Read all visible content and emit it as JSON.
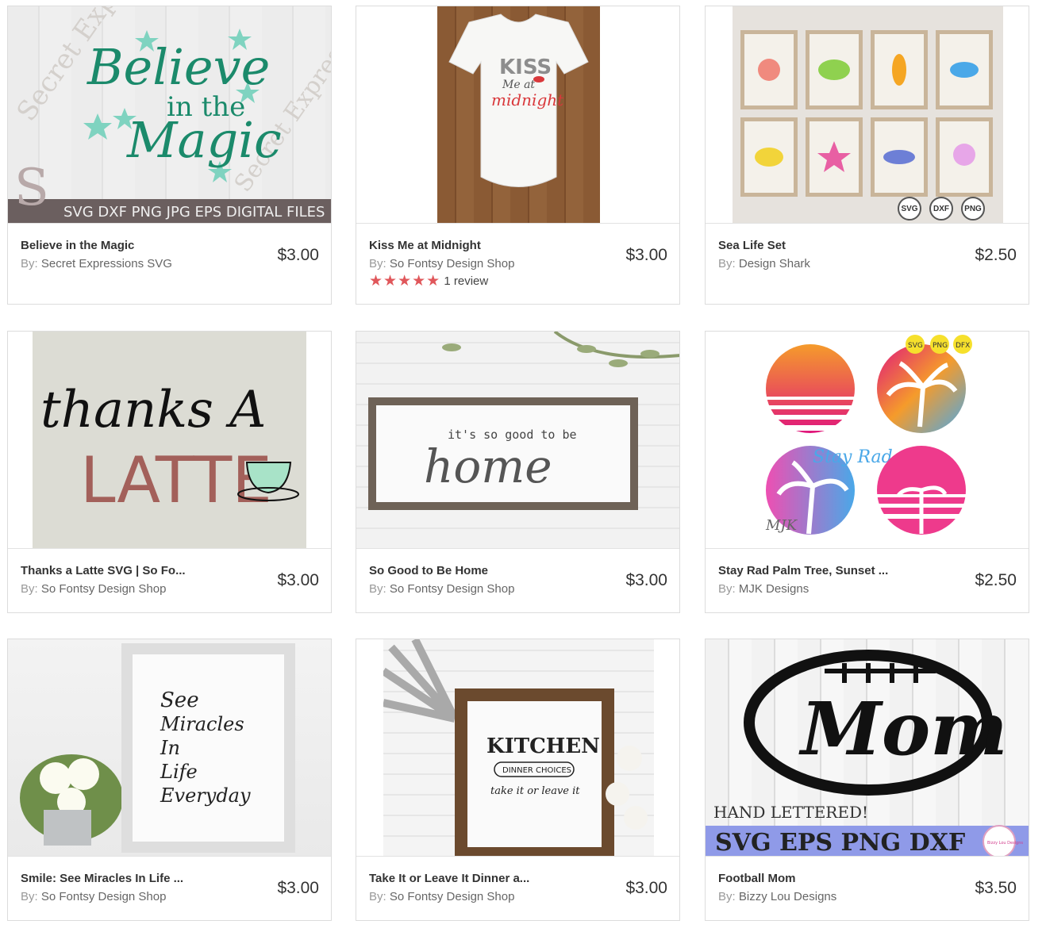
{
  "products": [
    {
      "title": "Believe in the Magic",
      "by_label": "By:",
      "author": "Secret Expressions SVG",
      "price": "$3.00",
      "art": {
        "line1": "Believe",
        "line2": "in the",
        "line3": "Magic",
        "watermark": "Secret Expressions",
        "footer": "SVG DXF PNG JPG EPS DIGITAL FILES",
        "colors": {
          "script": "#1b8a6b",
          "star": "#7fd3c0",
          "band": "#6b5f5f"
        }
      }
    },
    {
      "title": "Kiss Me at Midnight",
      "by_label": "By:",
      "author": "So Fontsy Design Shop",
      "price": "$3.00",
      "rating_stars": "★★★★★",
      "rating_text": "1 review",
      "art": {
        "line1": "KISS",
        "line2": "Me at",
        "line3": "midnight"
      }
    },
    {
      "title": "Sea Life Set",
      "by_label": "By:",
      "author": "Design Shark",
      "price": "$2.50",
      "art": {
        "chips": [
          "SVG",
          "DXF",
          "PNG"
        ]
      }
    },
    {
      "title": "Thanks a Latte SVG | So Fo...",
      "by_label": "By:",
      "author": "So Fontsy Design Shop",
      "price": "$3.00",
      "art": {
        "line1": "thanks A",
        "line2": "LATTE",
        "colors": {
          "latte": "#a3605a",
          "cup": "#a8e3c8"
        }
      }
    },
    {
      "title": "So Good to Be Home",
      "by_label": "By:",
      "author": "So Fontsy Design Shop",
      "price": "$3.00",
      "art": {
        "line1": "it's so good to be",
        "line2": "home"
      }
    },
    {
      "title": "Stay Rad Palm Tree, Sunset ...",
      "by_label": "By:",
      "author": "MJK Designs",
      "price": "$2.50",
      "art": {
        "chips": [
          "SVG",
          "PNG",
          "DFX"
        ],
        "script": "Stay Rad",
        "monogram": "MJK"
      }
    },
    {
      "title": "Smile: See Miracles In Life ...",
      "by_label": "By:",
      "author": "So Fontsy Design Shop",
      "price": "$3.00",
      "art": {
        "lines": [
          "See",
          "Miracles",
          "In",
          "Life",
          "Everyday"
        ]
      }
    },
    {
      "title": "Take It or Leave It Dinner a...",
      "by_label": "By:",
      "author": "So Fontsy Design Shop",
      "price": "$3.00",
      "art": {
        "line1": "KITCHEN",
        "line2": "DINNER CHOICES",
        "line3": "take it or leave it"
      }
    },
    {
      "title": "Football Mom",
      "by_label": "By:",
      "author": "Bizzy Lou Designs",
      "price": "$3.50",
      "art": {
        "word": "Mom",
        "caption": "HAND LETTERED!",
        "formats": "SVG EPS PNG DXF",
        "badge": "Bizzy Lou Designs"
      }
    }
  ]
}
